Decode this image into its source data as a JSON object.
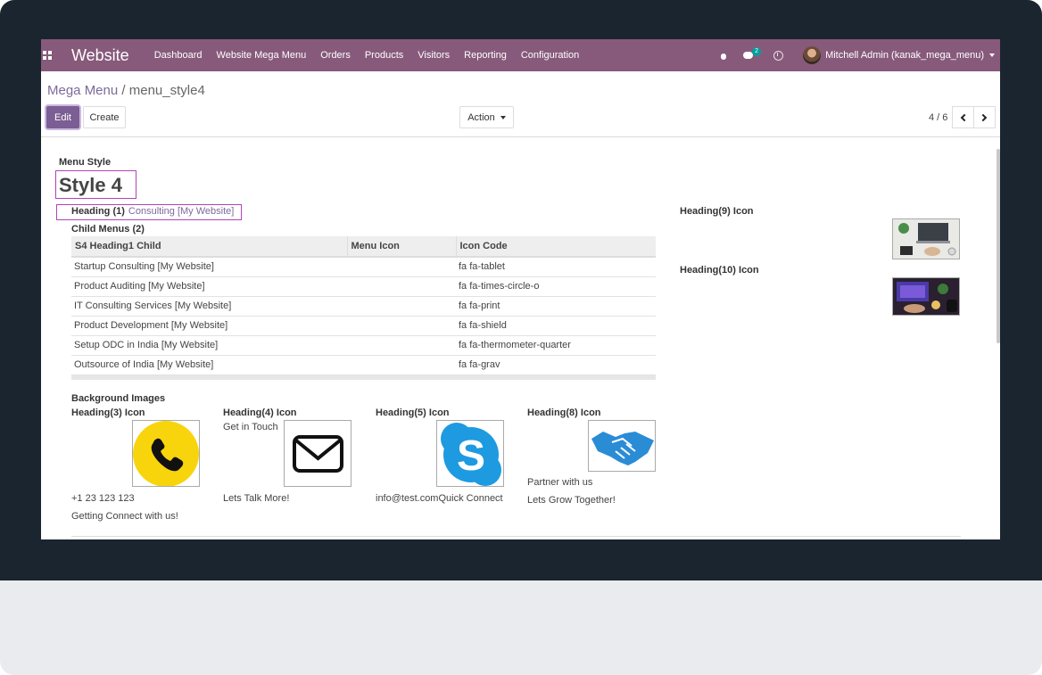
{
  "navbar": {
    "brand": "Website",
    "menu": [
      "Dashboard",
      "Website Mega Menu",
      "Orders",
      "Products",
      "Visitors",
      "Reporting",
      "Configuration"
    ],
    "chat_badge": "2",
    "user": "Mitchell Admin (kanak_mega_menu)"
  },
  "breadcrumb": {
    "parent": "Mega Menu",
    "separator": "/",
    "current": "menu_style4"
  },
  "toolbar": {
    "edit": "Edit",
    "create": "Create",
    "action": "Action",
    "pager": "4 / 6"
  },
  "form": {
    "menu_style_label": "Menu Style",
    "menu_style_value": "Style 4",
    "heading1_label": "Heading (1)",
    "heading1_value": "Consulting [My Website]",
    "child_menus_label": "Child Menus (2)",
    "table": {
      "headers": [
        "S4 Heading1 Child",
        "Menu Icon",
        "Icon Code"
      ],
      "rows": [
        [
          "Startup Consulting [My Website]",
          "",
          "fa fa-tablet"
        ],
        [
          "Product Auditing [My Website]",
          "",
          "fa fa-times-circle-o"
        ],
        [
          "IT Consulting Services [My Website]",
          "",
          "fa fa-print"
        ],
        [
          "Product Development [My Website]",
          "",
          "fa fa-shield"
        ],
        [
          "Setup ODC in India [My Website]",
          "",
          "fa fa-thermometer-quarter"
        ],
        [
          "Outsource of India [My Website]",
          "",
          "fa fa-grav"
        ]
      ]
    },
    "background_images_label": "Background Images",
    "heading3": {
      "label": "Heading(3) Icon",
      "line1": "+1 23 123 123",
      "line2": "Getting Connect with us!"
    },
    "heading4": {
      "label": "Heading(4) Icon",
      "top": "Get in Touch",
      "line1": "Lets Talk More!"
    },
    "heading5": {
      "label": "Heading(5) Icon",
      "line1": "info@test.comQuick Connect"
    },
    "heading8": {
      "label": "Heading(8) Icon",
      "line1": "Partner with us",
      "line2": "Lets Grow Together!"
    },
    "heading9_label": "Heading(9) Icon",
    "heading10_label": "Heading(10) Icon"
  },
  "colors": {
    "navbar": "#875a7b",
    "accent": "#7b5e93",
    "highlight": "#b143b7",
    "phone": "#f8d40c",
    "skype": "#1e9ae0",
    "handshake": "#2b8cd6"
  }
}
